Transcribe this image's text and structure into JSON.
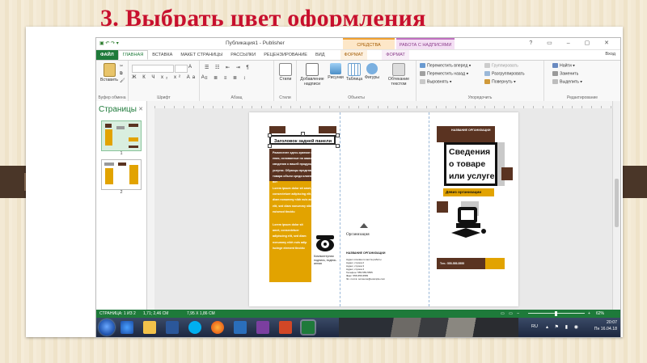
{
  "slide": {
    "title": "3. Выбрать цвет оформления"
  },
  "app": {
    "doc_title": "Публикация1 - Publisher",
    "context_tabs": {
      "drawing": "СРЕДСТВА РИСОВАНИЯ",
      "textbox": "РАБОТА С НАДПИСЯМИ"
    },
    "window_controls": "? ▭ – ▢ ✕",
    "sign_in": "Вход",
    "tabs": [
      "ФАЙЛ",
      "ГЛАВНАЯ",
      "ВСТАВКА",
      "МАКЕТ СТРАНИЦЫ",
      "РАССЫЛКИ",
      "РЕЦЕНЗИРОВАНИЕ",
      "ВИД",
      "ФОРМАТ",
      "ФОРМАТ"
    ],
    "active_tab_index": 1
  },
  "ribbon": {
    "paste": "Вставить",
    "clipboard_group": "Буфер обмена",
    "font_group": "Шрифт",
    "font_glyphs": "Ж К Ч х₂ х² Аа А",
    "paragraph_group": "Абзац",
    "styles": "Стили",
    "styles_group": "Стили",
    "add_textbox": "Добавление надписи",
    "pictures": "Рисунки",
    "table": "Таблица",
    "shapes": "Фигуры",
    "wrap_text": "Обтекание текстом",
    "objects_group": "Объекты",
    "bring_forward": "Переместить вперед",
    "send_backward": "Переместить назад",
    "align": "Выровнять",
    "group": "Группировать",
    "ungroup": "Разгруппировать",
    "rotate": "Повернуть",
    "arrange_group": "Упорядочить",
    "find": "Найти",
    "replace": "Заменить",
    "select": "Выделить",
    "editing_group": "Редактирование"
  },
  "pages_pane": {
    "header": "Страницы",
    "close": "✕",
    "pages": [
      "1",
      "2"
    ]
  },
  "publication": {
    "panel_heading": "Заголовок задней панели",
    "body_text_1": "Разместите здесь краткие свед-\nения, основанные на заказах,\nсведения о вашей продукции и\nуслугах. Образцы представления\nтовара объем среди клиентов\nвот",
    "lorem_1": "Lorem ipsum dolor sit amet,\nconsectetuer adipiscing elit, sed\ndiam nonummy nibh euis adipiscing\nelit, sed diam nonummy nibh\neuismod tincidu",
    "lorem_2": "Lorem ipsum dolor sit\namet, consectetuer\nadipiscing elit, sed diam\nnonummy nibh euis adip\niscinge element tincidu",
    "caption": "Компьютерная\nподпись, подпис-\nанная",
    "organization": "Организация",
    "company_name": "НАЗВАНИЕ ОРГАНИЗАЦИИ",
    "address": "Адрес основного места работы\nАдрес, строка 2\nАдрес, строка 3\nАдрес, строка 4\nТелефон: 555-555-5555\nФакс: 555-555-5555\nЭл. почта: someone@example.com",
    "company_name_top": "НАЗВАНИЕ ОРГАНИЗАЦИИ",
    "product_title": "Сведения о товаре или услуге",
    "org_band": "Девиз организации",
    "phone_band": "Тел.: 555-555-5555"
  },
  "status": {
    "page": "СТРАНИЦА: 1 ИЗ 2",
    "position": "1,71; 2,46 СМ",
    "size": "7,95 X 1,86 СМ",
    "zoom": "62%"
  },
  "taskbar": {
    "lang": "RU",
    "time": "20:07",
    "date": "Пн 16.04.18"
  },
  "colors": {
    "accent_orange": "#e2a300",
    "accent_brown": "#5a3321",
    "accent_gray": "#c9c9c9",
    "office_green": "#1e7a3a",
    "title_red": "#c8102e"
  }
}
